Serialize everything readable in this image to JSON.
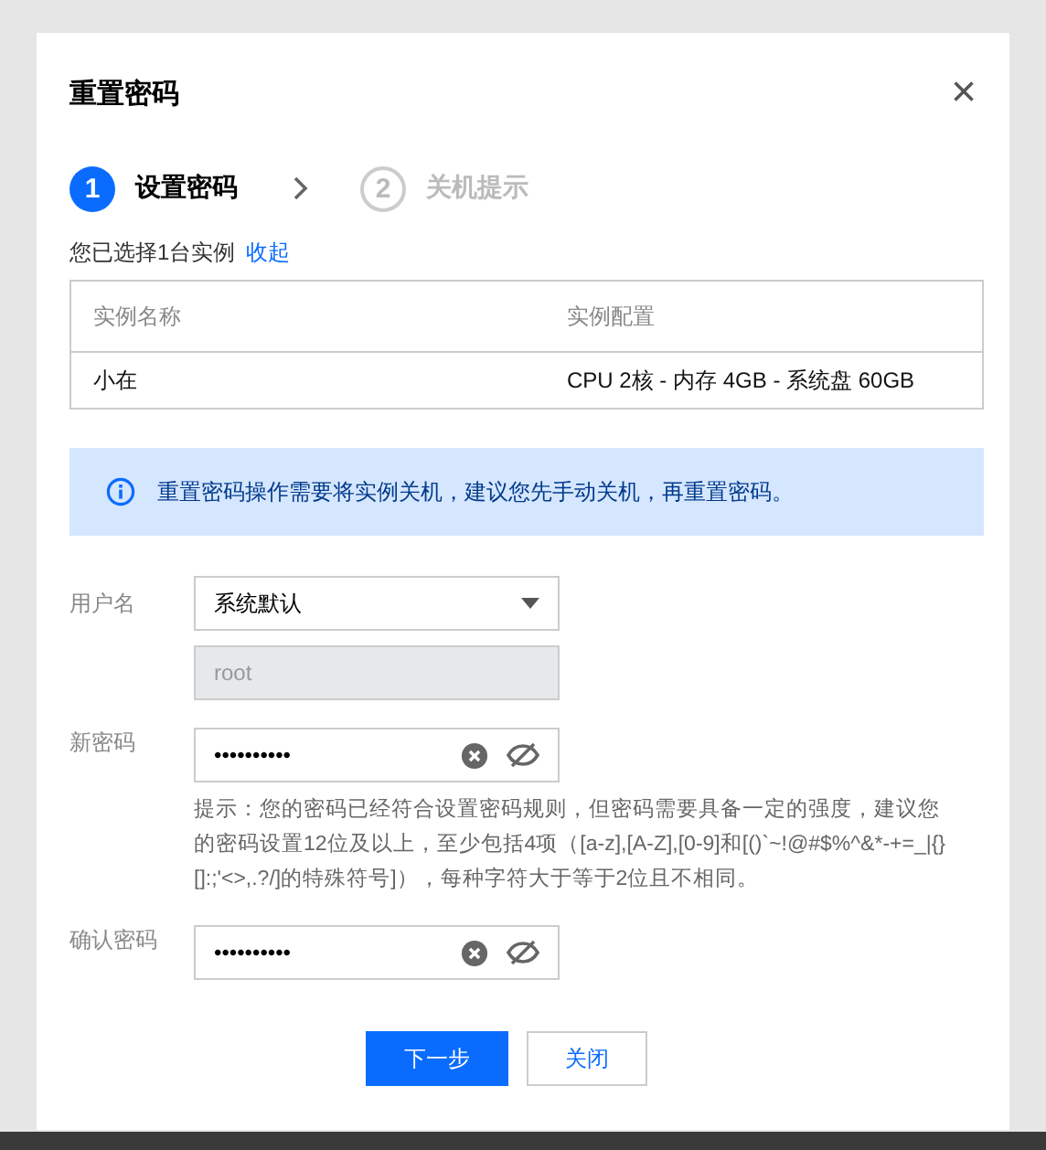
{
  "dialog": {
    "title": "重置密码",
    "close": "×"
  },
  "steps": [
    {
      "number": "1",
      "label": "设置密码",
      "selected": true
    },
    {
      "number": "2",
      "label": "关机提示",
      "selected": false
    }
  ],
  "selection": {
    "text": "您已选择1台实例",
    "link": "收起"
  },
  "table": {
    "columns": [
      "实例名称",
      "实例配置"
    ],
    "rows": [
      [
        "小在",
        "CPU 2核 - 内存 4GB - 系统盘 60GB"
      ]
    ]
  },
  "notice": "重置密码操作需要将实例关机，建议您先手动关机，再重置密码。",
  "form": {
    "username_label": "用户名",
    "username_select": "系统默认",
    "username_value": "root",
    "username_disabled": true,
    "new_password_label": "新密码",
    "new_password_value": "••••••••••",
    "hint": "提示：您的密码已经符合设置密码规则，但密码需要具备一定的强度，建议您的密码设置12位及以上，至少包括4项（[a-z],[A-Z],[0-9]和[()`~!@#$%^&*-+=_|{}[]:;'<>,.?/]的特殊符号]），每种字符大于等于2位且不相同。",
    "confirm_label": "确认密码",
    "confirm_value": "••••••••••"
  },
  "buttons": [
    {
      "label": "下一步",
      "kind": "primary"
    },
    {
      "label": "关闭",
      "kind": "secondary"
    }
  ]
}
